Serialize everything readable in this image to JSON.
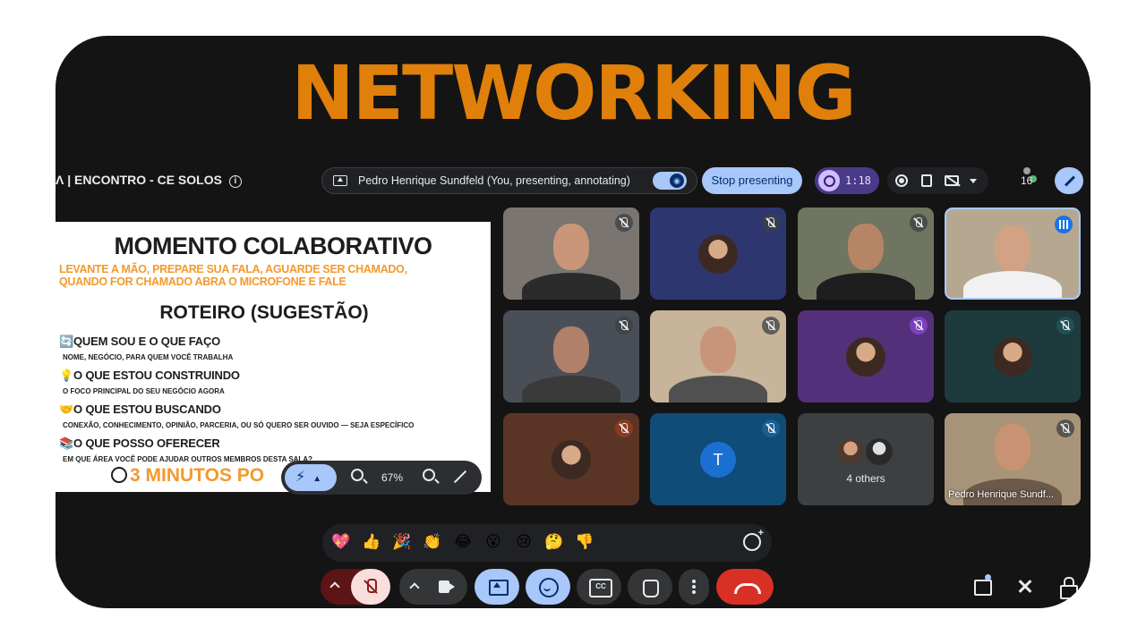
{
  "banner": {
    "text": "NETWORKING"
  },
  "meeting": {
    "title": "Λ  |  ENCONTRO - CE SOLOS"
  },
  "presenting": {
    "label": "Pedro Henrique Sundfeld (You, presenting, annotating)",
    "stop_label": "Stop presenting"
  },
  "timer": {
    "value": "1:18"
  },
  "participants": {
    "count": "16"
  },
  "slide": {
    "title": "MOMENTO COLABORATIVO",
    "instructions_line1": "LEVANTE A MÃO, PREPARE SUA FALA, AGUARDE SER CHAMADO,",
    "instructions_line2": "QUANDO FOR CHAMADO ABRA O MICROFONE E FALE",
    "subtitle": "ROTEIRO (SUGESTÃO)",
    "items": [
      {
        "emoji": "🔄",
        "heading": "QUEM SOU E O QUE FAÇO",
        "note": "NOME, NEGÓCIO, PARA QUEM VOCÊ TRABALHA"
      },
      {
        "emoji": "💡",
        "heading": "O QUE ESTOU CONSTRUINDO",
        "note": "O FOCO PRINCIPAL DO SEU NEGÓCIO AGORA"
      },
      {
        "emoji": "🤝",
        "heading": "O QUE ESTOU BUSCANDO",
        "note": "CONEXÃO, CONHECIMENTO, OPINIÃO, PARCERIA,  OU SÓ QUERO SER OUVIDO — SEJA ESPECÍFICO"
      },
      {
        "emoji": "📚",
        "heading": "O QUE POSSO OFERECER",
        "note": "EM QUE ÁREA VOCÊ PODE AJUDAR OUTROS  MEMBROS DESTA SALA?"
      }
    ],
    "footer": "3 MINUTOS PO"
  },
  "zoom": {
    "value": "67%"
  },
  "tiles": [
    {
      "name": "",
      "letter": ""
    },
    {
      "name": "",
      "letter": ""
    },
    {
      "name": "",
      "letter": ""
    },
    {
      "name": "",
      "letter": ""
    },
    {
      "name": "",
      "letter": ""
    },
    {
      "name": "",
      "letter": ""
    },
    {
      "name": "",
      "letter": ""
    },
    {
      "name": "",
      "letter": ""
    },
    {
      "name": "",
      "letter": ""
    },
    {
      "name": "",
      "letter": "T"
    },
    {
      "name": "4 others",
      "letter": ""
    },
    {
      "name": "Pedro Henrique Sundf...",
      "letter": ""
    }
  ],
  "reactions": [
    "💖",
    "👍",
    "🎉",
    "👏",
    "😂",
    "😮",
    "😢",
    "🤔",
    "👎"
  ],
  "colors": {
    "banner": "#e07f0a",
    "accent_blue": "#a8c7fa",
    "leave_red": "#d93025",
    "slide_orange": "#f29a2e"
  }
}
